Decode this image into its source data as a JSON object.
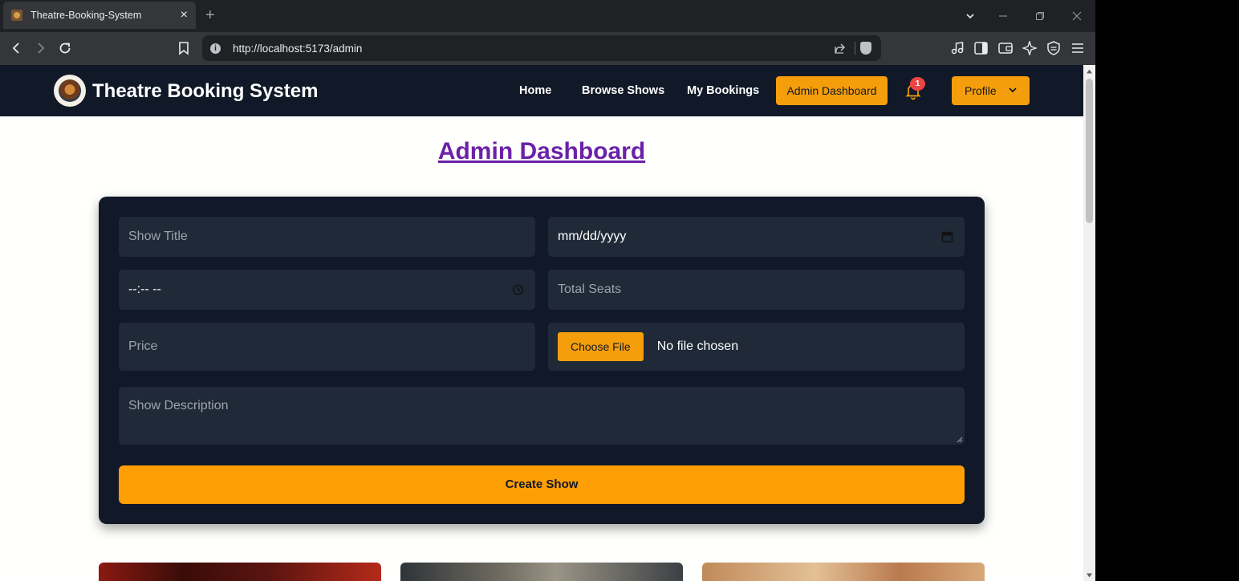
{
  "browser": {
    "tab_title": "Theatre-Booking-System",
    "tab_close": "×",
    "new_tab": "+",
    "url": "http://localhost:5173/admin",
    "info": "i"
  },
  "nav": {
    "brand": "Theatre Booking System",
    "links": [
      "Home",
      "Browse Shows",
      "My Bookings"
    ],
    "admin_button": "Admin Dashboard",
    "notification_count": "1",
    "profile_button": "Profile"
  },
  "page": {
    "title": "Admin Dashboard"
  },
  "form": {
    "show_title_placeholder": "Show Title",
    "date_value": "mm/dd/yyyy",
    "time_value": "--:-- --",
    "total_seats_placeholder": "Total Seats",
    "price_placeholder": "Price",
    "file_button": "Choose File",
    "file_status": "No file chosen",
    "description_placeholder": "Show Description",
    "submit": "Create Show"
  },
  "colors": {
    "nav_bg": "#111827",
    "accent": "#f59e0b",
    "title": "#6b21a8",
    "field_bg": "#1f2937"
  }
}
